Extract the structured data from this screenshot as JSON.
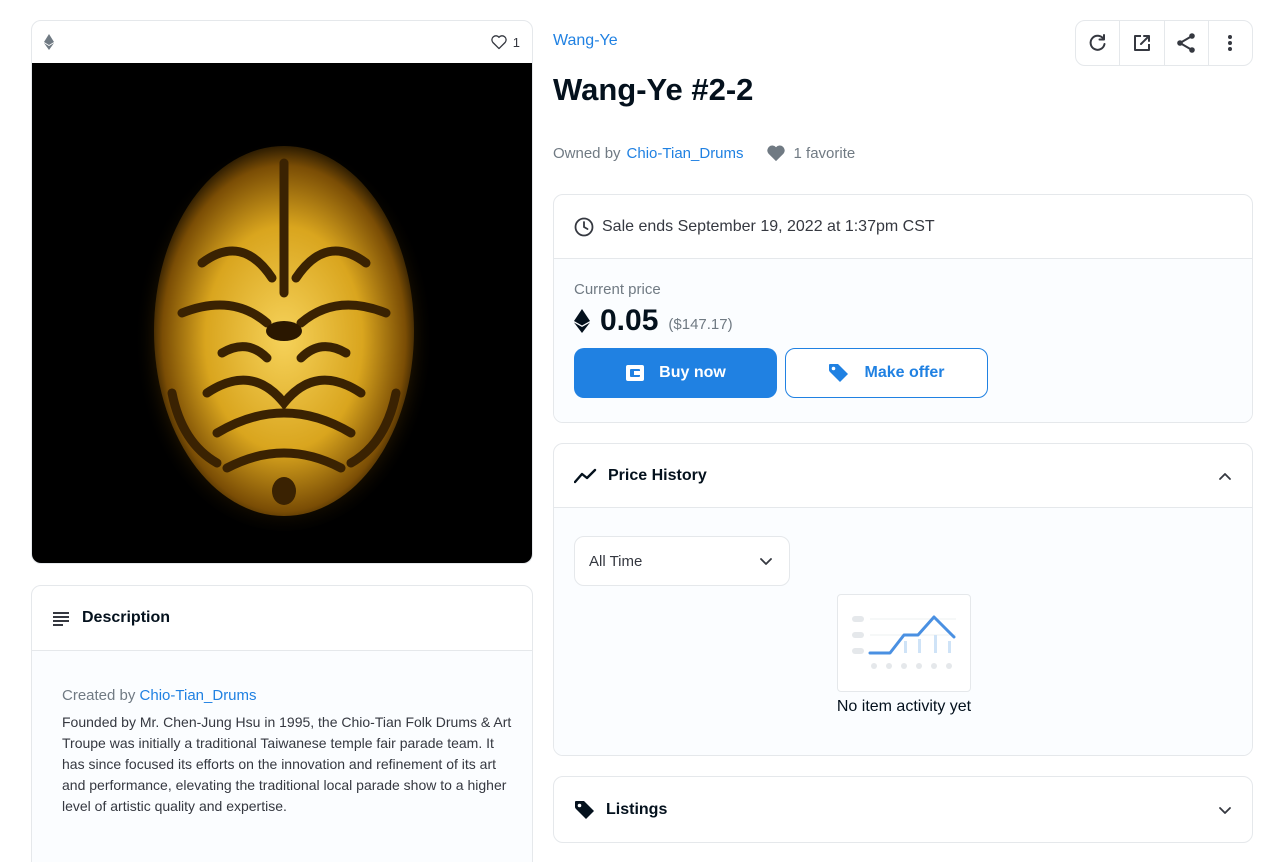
{
  "media": {
    "favorite_count": "1"
  },
  "description": {
    "heading": "Description",
    "created_by_prefix": "Created by",
    "creator": "Chio-Tian_Drums",
    "text": "Founded by Mr. Chen-Jung Hsu in 1995, the Chio-Tian Folk Drums & Art Troupe was initially a traditional Taiwanese temple fair parade team. It has since focused its efforts on the innovation and refinement of its art and performance, elevating the traditional local parade show to a higher level of artistic quality and expertise."
  },
  "item": {
    "collection": "Wang-Ye",
    "title": "Wang-Ye #2-2",
    "owned_by_prefix": "Owned by",
    "owner": "Chio-Tian_Drums",
    "favorites": "1 favorite"
  },
  "toolbar": {
    "icons": [
      "refresh-icon",
      "external-link-icon",
      "share-icon",
      "more-icon"
    ]
  },
  "sale": {
    "ends": "Sale ends September 19, 2022 at 1:37pm CST",
    "current_price_label": "Current price",
    "price": "0.05",
    "usd": "($147.17)",
    "buy_now": "Buy now",
    "make_offer": "Make offer"
  },
  "price_history": {
    "heading": "Price History",
    "range_selected": "All Time",
    "empty_text": "No item activity yet"
  },
  "listings": {
    "heading": "Listings"
  },
  "colors": {
    "accent": "#2081e2",
    "border": "#e5e8eb",
    "text_dark": "#04111d",
    "text_muted": "#707a83"
  }
}
